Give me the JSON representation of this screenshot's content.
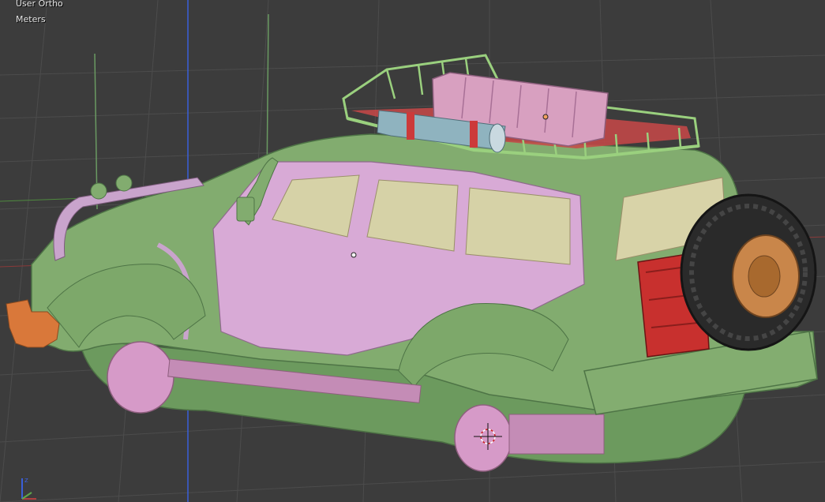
{
  "viewport": {
    "view_name": "User Ortho",
    "units": "Meters"
  },
  "colors": {
    "background": "#3c3c3c",
    "grid": "#4b4b4b",
    "body_green": "#7fa86a",
    "body_pink": "#d9a8d6",
    "window": "#d8d3a8",
    "tire": "#2a2a2a",
    "rim": "#c9864a",
    "fuel_can": "#c42a2a",
    "tow_hook": "#d9783a",
    "axis_blue": "#3a5fd9",
    "axis_green": "#5fa84a",
    "axis_red": "#b04040"
  },
  "icons": {
    "axis_gizmo": "xyz-axis-gizmo-icon",
    "cursor_3d": "3d-cursor-icon"
  }
}
